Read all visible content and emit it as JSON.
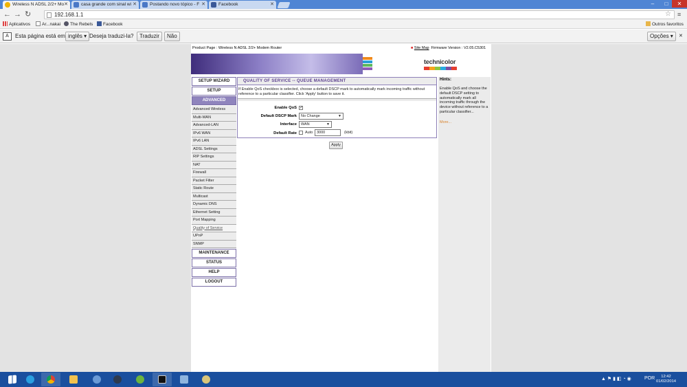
{
  "browser": {
    "tabs": [
      {
        "label": "Wireless N ADSL 2/2+ Mo",
        "active": true,
        "icon": "warning-icon"
      },
      {
        "label": "casa grande com sinal wi",
        "active": false,
        "icon": "forum-icon"
      },
      {
        "label": "Postando novo tópico - F",
        "active": false,
        "icon": "forum-icon"
      },
      {
        "label": "Facebook",
        "active": false,
        "icon": "facebook-icon"
      }
    ],
    "window_controls": {
      "minimize": "–",
      "maximize": "□",
      "close": "✕"
    },
    "back": "←",
    "forward": "→",
    "reload": "↻",
    "url": "192.168.1.1",
    "star": "☆",
    "menu": "≡",
    "bookmarks": [
      {
        "label": "Aplicativos",
        "icon": "apps-icon"
      },
      {
        "label": "Ar...nakai",
        "icon": "page-icon"
      },
      {
        "label": "The Rebels",
        "icon": "rebels-icon"
      },
      {
        "label": "Facebook",
        "icon": "facebook-icon"
      }
    ],
    "other_bookmarks": "Outros favoritos"
  },
  "translate": {
    "icon": "translate-icon",
    "prompt": "Esta página está em",
    "language": "inglês",
    "question": "Deseja traduzi-la?",
    "translate_btn": "Traduzir",
    "no_btn": "Não",
    "options_btn": "Opções",
    "close": "✕"
  },
  "router": {
    "product": "Product Page : Wireless N ADSL 2/2+ Modem Router",
    "sitemap_label": "Site Map",
    "firmware": "Firmware Version : V2.05.C5301",
    "logo": "technicolor",
    "nav_top": [
      "SETUP WIZARD",
      "SETUP",
      "ADVANCED"
    ],
    "advanced_items": [
      "Advanced Wireless",
      "Multi-WAN",
      "Advanced-LAN",
      "IPv6 WAN",
      "IPv6 LAN",
      "ADSL Settings",
      "RIP Settings",
      "NAT",
      "Firewall",
      "Packet Filter",
      "Static Route",
      "Multicast",
      "Dynamic DNS",
      "Ethernet Setting",
      "Port Mapping",
      "Quality of Service",
      "UPnP",
      "SNMP"
    ],
    "nav_bottom": [
      "MAINTENANCE",
      "STATUS",
      "HELP",
      "LOGOUT"
    ],
    "qos": {
      "title": "QUALITY OF SERVICE -- QUEUE MANAGEMENT",
      "description": "If Enable QoS checkbox is selected, choose a default DSCP mark to automatically mark incoming traffic without reference to a particular classifier. Click 'Apply' button to save it.",
      "enable_label": "Enable QoS",
      "enable_checked": "✓",
      "dscp_label": "Default DSCP Mark",
      "dscp_value": "No Change",
      "interface_label": "Interface",
      "interface_value": "WAN",
      "rate_label": "Default Rate",
      "rate_auto": "Auto",
      "rate_value": "3000",
      "rate_unit": "(kbit)",
      "apply": "Apply",
      "select_arrow": "▼"
    },
    "hints": {
      "title": "Hints:",
      "text": "Enable QoS and choose the default DSCP setting to automatically mark all incoming traffic through the device without reference to a particular classifier...",
      "more": "More..."
    }
  },
  "taskbar": {
    "apps": [
      "windows-start-icon",
      "internet-explorer-icon",
      "chrome-icon",
      "file-explorer-icon",
      "media-player-icon",
      "steam-icon",
      "utorrent-icon",
      "cmd-icon",
      "app-icon",
      "app2-icon"
    ],
    "tray_language": "POR",
    "time": "12:42",
    "date": "01/02/2014"
  }
}
